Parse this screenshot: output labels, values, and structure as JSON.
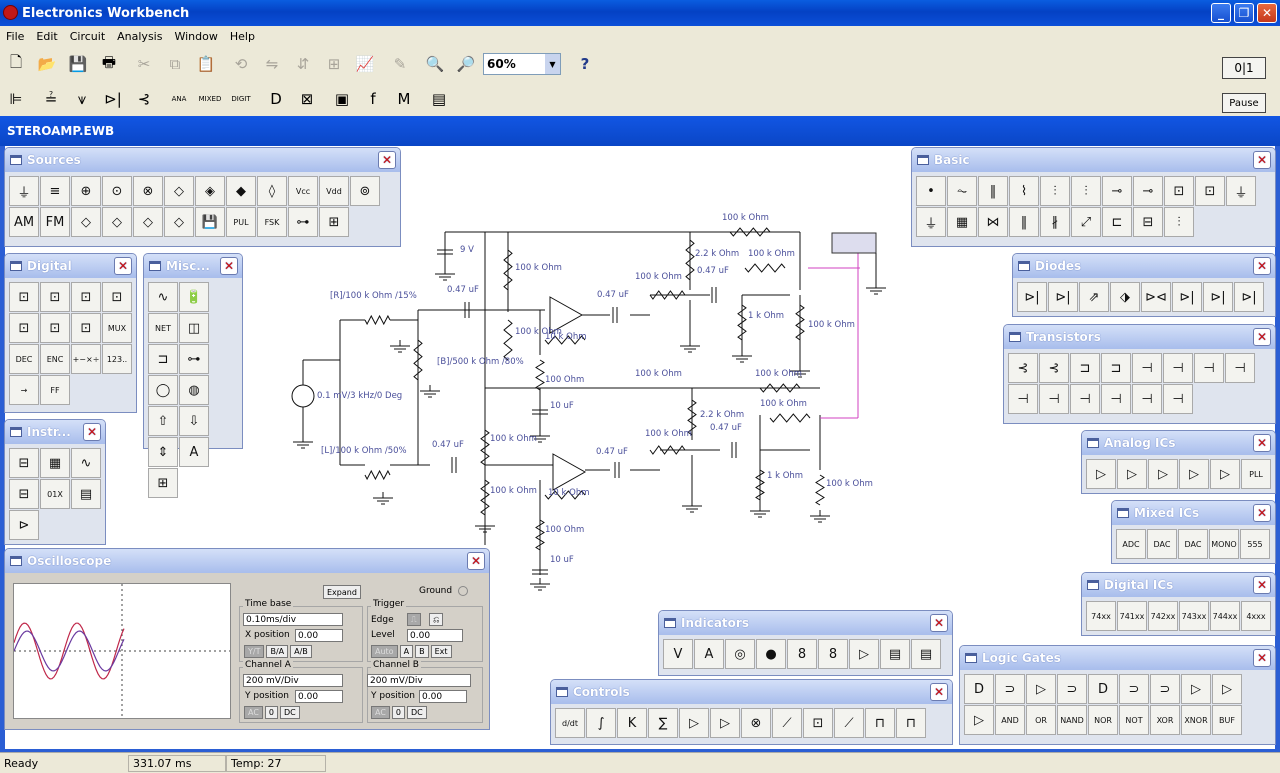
{
  "window": {
    "title": "Electronics Workbench",
    "icon": "app-logo-icon"
  },
  "menu": [
    "File",
    "Edit",
    "Circuit",
    "Analysis",
    "Window",
    "Help"
  ],
  "toolbar1": {
    "buttons": [
      {
        "name": "new-icon",
        "g": "🗋"
      },
      {
        "name": "open-icon",
        "g": "📂"
      },
      {
        "name": "save-icon",
        "g": "💾"
      },
      {
        "name": "print-icon",
        "g": "🖶"
      },
      {
        "name": "cut-icon",
        "g": "✂",
        "dis": true
      },
      {
        "name": "copy-icon",
        "g": "⧉",
        "dis": true
      },
      {
        "name": "paste-icon",
        "g": "📋"
      },
      {
        "name": "rotate-icon",
        "g": "⟲",
        "dis": true
      },
      {
        "name": "flip-horizontal-icon",
        "g": "⇋",
        "dis": true
      },
      {
        "name": "flip-vertical-icon",
        "g": "⇵",
        "dis": true
      },
      {
        "name": "subcircuit-icon",
        "g": "⊞",
        "dis": true
      },
      {
        "name": "graph-icon",
        "g": "📈"
      },
      {
        "name": "component-properties-icon",
        "g": "✎",
        "dis": true
      },
      {
        "name": "zoom-out-icon",
        "g": "🔍"
      },
      {
        "name": "zoom-in-icon",
        "g": "🔎"
      }
    ],
    "zoom": "60%",
    "help": "?"
  },
  "toolbar2": {
    "buttons": [
      {
        "name": "parts-bin-toggle-icon",
        "g": "⊫"
      },
      {
        "name": "sources-bin-icon",
        "g": "≟"
      },
      {
        "name": "basic-bin-icon",
        "g": "⩛"
      },
      {
        "name": "diodes-bin-icon",
        "g": "⊳|"
      },
      {
        "name": "transistors-bin-icon",
        "g": "⊰"
      },
      {
        "name": "analog-ics-bin-icon",
        "g": "ANA"
      },
      {
        "name": "mixed-ics-bin-icon",
        "g": "MIXED"
      },
      {
        "name": "digital-ics-bin-icon",
        "g": "DIGIT"
      },
      {
        "name": "logic-gates-bin-icon",
        "g": "D"
      },
      {
        "name": "digital-bin-icon",
        "g": "⊠"
      },
      {
        "name": "indicators-bin-icon",
        "g": "▣"
      },
      {
        "name": "controls-bin-icon",
        "g": "f"
      },
      {
        "name": "misc-bin-icon",
        "g": "M"
      },
      {
        "name": "instruments-bin-icon",
        "g": "▤"
      }
    ]
  },
  "power_switch": "0|1",
  "pause": "Pause",
  "document": {
    "title": "STEROAMP.EWB"
  },
  "panels": {
    "sources": {
      "title": "Sources",
      "items": [
        "⏚",
        "≡",
        "⊕",
        "⊙",
        "⊗",
        "◇",
        "◈",
        "◆",
        "◊",
        "Vcc",
        "Vdd",
        "⊚",
        "AM",
        "FM",
        "◇",
        "◇",
        "◇",
        "◇",
        "💾",
        "PUL",
        "FSK",
        "⊶",
        "⊞"
      ]
    },
    "basic": {
      "title": "Basic",
      "items": [
        "•",
        "⏦",
        "‖",
        "⌇",
        "⫶",
        "⫶",
        "⊸",
        "⊸",
        "⊡",
        "⊡",
        "⏚",
        "⏚",
        "▦",
        "⋈",
        "‖",
        "∦",
        "⤢",
        "⊏",
        "⊟",
        "⫶"
      ]
    },
    "diodes": {
      "title": "Diodes",
      "items": [
        "⊳|",
        "⊳|",
        "⇗",
        "⬗",
        "⊳⊲",
        "⊳|",
        "⊳|",
        "⊳|"
      ]
    },
    "transistors": {
      "title": "Transistors",
      "items": [
        "⊰",
        "⊰",
        "⊐",
        "⊐",
        "⊣",
        "⊣",
        "⊣",
        "⊣",
        "⊣",
        "⊣",
        "⊣",
        "⊣",
        "⊣",
        "⊣"
      ]
    },
    "analog_ics": {
      "title": "Analog ICs",
      "items": [
        "▷",
        "▷",
        "▷",
        "▷",
        "▷",
        "PLL"
      ]
    },
    "mixed_ics": {
      "title": "Mixed ICs",
      "items": [
        "ADC",
        "DAC",
        "DAC",
        "MONO",
        "555"
      ]
    },
    "digital_ics": {
      "title": "Digital ICs",
      "items": [
        "74xx",
        "741xx",
        "742xx",
        "743xx",
        "744xx",
        "4xxx"
      ]
    },
    "logic_gates": {
      "title": "Logic Gates",
      "items": [
        "D",
        "⊃",
        "▷",
        "⊃",
        "D",
        "⊃",
        "⊃",
        "▷",
        "▷",
        "▷"
      ],
      "labels": [
        "AND",
        "OR",
        "NAND",
        "NOR",
        "NOT",
        "XOR",
        "XNOR",
        "BUF"
      ]
    },
    "indicators": {
      "title": "Indicators",
      "items": [
        "V",
        "A",
        "◎",
        "●",
        "8",
        "8",
        "▷",
        "▤",
        "▤"
      ]
    },
    "controls": {
      "title": "Controls",
      "items": [
        "d/dt",
        "∫",
        "K",
        "∑",
        "▷",
        "▷",
        "⊗",
        "⟋",
        "⊡",
        "⟋",
        "⊓",
        "⊓"
      ]
    },
    "digital": {
      "title": "Digital",
      "items": [
        "⊡",
        "⊡",
        "⊡",
        "⊡",
        "⊡",
        "⊡",
        "⊡"
      ],
      "labels": [
        "MUX",
        "DEC",
        "ENC",
        "+−×÷",
        "123..",
        "→",
        "FF"
      ]
    },
    "misc": {
      "title": "Misc...",
      "items": [
        "∿",
        "🔋",
        "NET",
        "◫",
        "⊐",
        "⊶",
        "◯",
        "◍",
        "⇧",
        "⇩",
        "⇕",
        "A",
        "⊞"
      ]
    },
    "instruments": {
      "title": "Instr...",
      "items": [
        "⊟",
        "▦",
        "∿",
        "⊟",
        "01X",
        "▤",
        "⊳"
      ]
    }
  },
  "oscilloscope": {
    "title": "Oscilloscope",
    "expand": "Expand",
    "ground": "Ground",
    "timebase": {
      "label": "Time base",
      "value": "0.10ms/div",
      "xpos_label": "X position",
      "xpos": "0.00",
      "modes": [
        "Y/T",
        "B/A",
        "A/B"
      ]
    },
    "trigger": {
      "label": "Trigger",
      "edge": "Edge",
      "level_label": "Level",
      "level": "0.00",
      "modes": [
        "Auto",
        "A",
        "B",
        "Ext"
      ]
    },
    "channel_a": {
      "label": "Channel A",
      "value": "200 mV/Div",
      "ypos_label": "Y position",
      "ypos": "0.00",
      "coupling": [
        "AC",
        "0",
        "DC"
      ]
    },
    "channel_b": {
      "label": "Channel B",
      "value": "200 mV/Div",
      "ypos_label": "Y position",
      "ypos": "0.00",
      "coupling": [
        "AC",
        "0",
        "DC"
      ]
    }
  },
  "circuit_labels": [
    "9 V",
    "100 k Ohm",
    "100 k Ohm",
    "2.2 k Ohm",
    "100 k Ohm",
    "100 k Ohm",
    "0.47 uF",
    "0.47 uF",
    "[R]/100 k Ohm /15%",
    "0.47 uF",
    "100 k Ohm",
    "100 k Ohm",
    "10 k Ohm",
    "1 k Ohm",
    "100 k Ohm",
    "[B]/500 k Ohm /80%",
    "0.1 mV/3 kHz/0 Deg",
    "100  Ohm",
    "10 uF",
    "100 k Ohm",
    "100 k Ohm",
    "2.2 k Ohm",
    "100 k Ohm",
    "0.47 uF",
    "100 k Ohm",
    "0.47 uF",
    "[L]/100 k Ohm /50%",
    "0.47 uF",
    "100 k Ohm",
    "10 k Ohm",
    "1 k Ohm",
    "100 k Ohm",
    "100  Ohm",
    "10 uF"
  ],
  "status": {
    "ready": "Ready",
    "time": "331.07 ms",
    "temp": "Temp:  27"
  }
}
